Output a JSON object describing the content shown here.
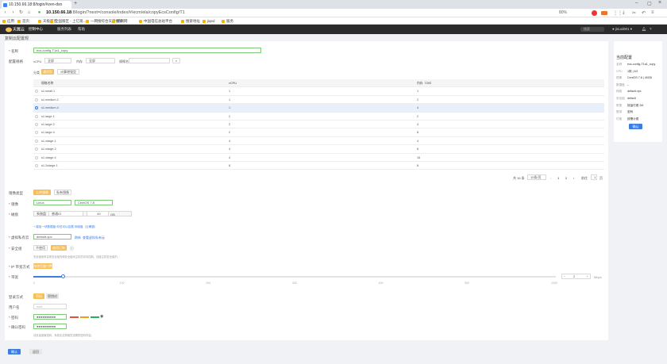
{
  "browser": {
    "tab_title": "10.150.66.18:8/login/#zen-dsn",
    "url_host": "10.150.66.18",
    "url_rest": ":8/login/?next=/console/index/#/ecm/ela/copyEcsConfig/T1",
    "zoom": "80%",
    "bookmarks": [
      "应用",
      "首页",
      "天极首页",
      "全国版区 - 上亿观...",
      "一网搜综合天津搜索",
      "百度地图",
      "新闻网",
      "今日资讯...的采购",
      "中国电信总站平台",
      "搜索地址",
      "jiqed",
      "服务"
    ]
  },
  "header": {
    "logo_text": "天翼云",
    "logo_sub": "Cloud",
    "nav": [
      "控制中心",
      "服务列表",
      "帮助"
    ],
    "region": "区域1",
    "search_placeholder": "搜索",
    "user": "jisuxi001",
    "icons": [
      "bell-icon",
      "help-icon"
    ]
  },
  "page": {
    "breadcrumb": "复制云配置规",
    "name_label": "名称",
    "name_value": "ecs-config-T1a1_copy",
    "spec_label": "配置规格",
    "filter": {
      "vcpu_label": "vCPU",
      "vcpu_value": "全部",
      "mem_label": "内存",
      "mem_value": "全部",
      "flavor_label": "规格名称",
      "flavor_placeholder": ""
    },
    "type_tabs": [
      "通用型",
      "计算增强型"
    ],
    "type_label": "分类",
    "table": {
      "headers": [
        "规格名称",
        "vCPU",
        "内存（GB）"
      ],
      "rows": [
        [
          "s1.small.1",
          "1",
          "1"
        ],
        [
          "s1.medium.2",
          "1",
          "2"
        ],
        [
          "s1.medium.4",
          "1",
          "4"
        ],
        [
          "s1.large.1",
          "2",
          "2"
        ],
        [
          "s1.large.2",
          "2",
          "4"
        ],
        [
          "s1.large.4",
          "2",
          "8"
        ],
        [
          "s1.xlarge.1",
          "4",
          "4"
        ],
        [
          "s1.xlarge.2",
          "4",
          "8"
        ],
        [
          "s1.xlarge.4",
          "4",
          "16"
        ],
        [
          "s1.2xlarge.1",
          "8",
          "8"
        ]
      ],
      "selected_index": 2
    },
    "pagination": {
      "total": "共 16 条",
      "page_size": "10条/页",
      "pages": [
        "1",
        "2"
      ],
      "current": "1",
      "goto_label": "前往",
      "goto_value": "1",
      "page_suffix": "页"
    },
    "image_label": "镜像类型",
    "image_tabs": [
      "公共镜像",
      "私有镜像"
    ],
    "os_label": "镜像",
    "os_value": "Linux",
    "os_version": "CentOS 7.8",
    "disk_label": "磁盘",
    "disk_type": "系统盘",
    "disk_kind": "普通IO",
    "disk_size": "40",
    "disk_unit": "GB",
    "disk_note": "+ 增加一块数据盘 你还可以挂载 块磁盘（云硬盘）",
    "vpc_label": "虚拟私有云",
    "vpc_value": "default-vpc",
    "vpc_link": "刷新",
    "vpc_create": "查看虚拟私有云",
    "sg_label": "安全组",
    "sg_buttons": [
      "不使用",
      "使用已有"
    ],
    "sg_note": "安全组用来实现安全组内和安全组间主机的访问控制，加强主机安全保护。",
    "ip_label": "IP 带宽方式",
    "ip_button": "按使用量付费",
    "bw_label": "带宽",
    "bw_value": "2",
    "bw_unit": "Mbps",
    "bw_ticks": [
      "0",
      "100",
      "200",
      "300",
      "400",
      "500",
      "1000"
    ],
    "bw_fraction": 0.057,
    "login_label": "登录方式",
    "login_tabs": [
      "密码",
      "密钥对"
    ],
    "user_label": "用户名",
    "user_value": "root",
    "pwd_label": "密码",
    "pwd_value": "●●●●●●●●●●",
    "pwd_confirm_label": "确认密码",
    "pwd_confirm_value": "●●●●●●●●●●",
    "pwd_note": "请妥善保管密码，系统无法获取您设置的密码内容。",
    "pwd_strength_colors": [
      "#e74c3c",
      "#f39c12",
      "#27ae60"
    ]
  },
  "summary": {
    "title": "当前配置",
    "rows": [
      [
        "名称",
        "ecs-config-T1a1_copy"
      ],
      [
        "CPU",
        "1核 | 4G"
      ],
      [
        "镜像",
        "CentOS 7.8 | 40GB"
      ],
      [
        "数据盘",
        "--"
      ],
      [
        "网络",
        "default-vpc"
      ],
      [
        "安全组",
        "default"
      ],
      [
        "带宽",
        "按量付费 2M"
      ],
      [
        "登录",
        "密码"
      ],
      [
        "付费",
        "按需计费"
      ]
    ],
    "confirm": "确认"
  },
  "footer": {
    "ok": "确认",
    "cancel": "返回"
  },
  "colors": {
    "accent": "#f6bd58",
    "header_bg": "#2b2b2b",
    "link": "#3b7de0"
  }
}
